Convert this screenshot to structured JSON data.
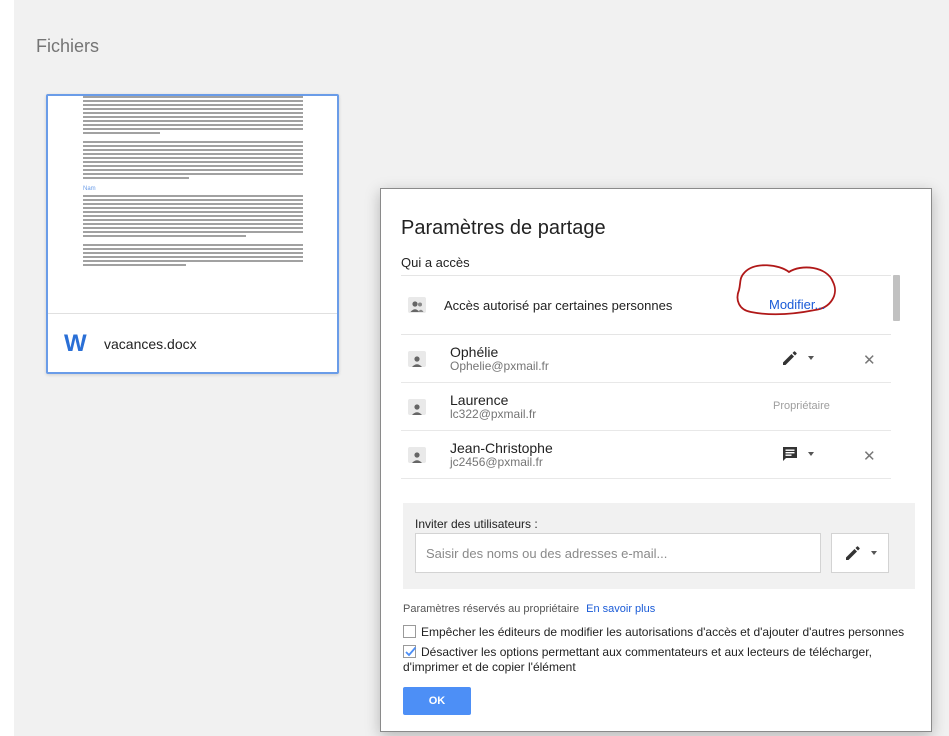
{
  "page": {
    "title": "Fichiers"
  },
  "file": {
    "name": "vacances.docx",
    "type_icon": "word-doc-icon",
    "icon_letter": "W",
    "preview_heading": "Nam"
  },
  "dialog": {
    "title": "Paramètres de partage",
    "who_has_access": "Qui a accès",
    "access_summary": "Accès autorisé par certaines personnes",
    "modify_link": "Modifier...",
    "people": [
      {
        "name": "Ophélie",
        "email": "Ophelie@pxmail.fr",
        "permission_icon": "pencil-icon",
        "removable": true
      },
      {
        "name": "Laurence",
        "email": "lc322@pxmail.fr",
        "role": "Propriétaire",
        "removable": false
      },
      {
        "name": "Jean-Christophe",
        "email": "jc2456@pxmail.fr",
        "permission_icon": "comment-icon",
        "removable": true
      }
    ],
    "invite": {
      "label": "Inviter des utilisateurs :",
      "placeholder": "Saisir des noms ou des adresses e-mail...",
      "permission_icon": "pencil-icon"
    },
    "owner_settings": {
      "label": "Paramètres réservés au propriétaire",
      "learn_more": "En savoir plus",
      "options": [
        {
          "label": "Empêcher les éditeurs de modifier les autorisations d'accès et d'ajouter d'autres personnes",
          "checked": false
        },
        {
          "label": "Désactiver les options permettant aux commentateurs et aux lecteurs de télécharger, d'imprimer et de copier l'élément",
          "checked": true
        }
      ]
    },
    "ok_label": "OK"
  },
  "colors": {
    "accent_blue": "#4d8ff6",
    "link_blue": "#1a5bd7",
    "card_border": "#6a9ce8",
    "annotation_red": "#b01818"
  }
}
